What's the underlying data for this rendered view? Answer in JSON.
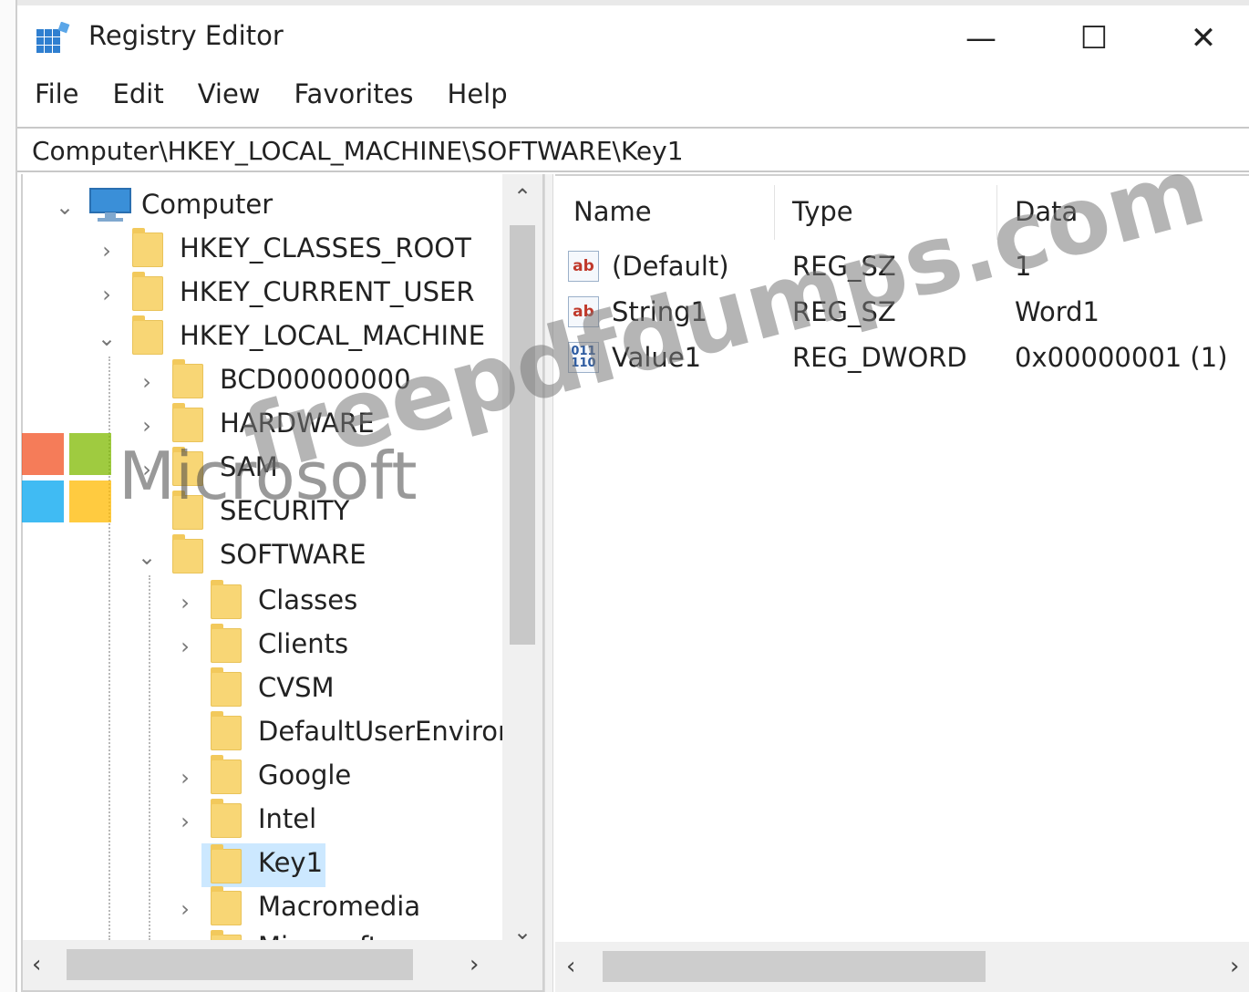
{
  "window": {
    "title": "Registry Editor",
    "controls": {
      "minimize": "—",
      "maximize": "☐",
      "close": "✕"
    }
  },
  "menu": [
    "File",
    "Edit",
    "View",
    "Favorites",
    "Help"
  ],
  "address": "Computer\\HKEY_LOCAL_MACHINE\\SOFTWARE\\Key1",
  "tree": {
    "root": "Computer",
    "hives": [
      "HKEY_CLASSES_ROOT",
      "HKEY_CURRENT_USER",
      "HKEY_LOCAL_MACHINE"
    ],
    "hklm_children": [
      "BCD00000000",
      "HARDWARE",
      "SAM",
      "SECURITY",
      "SOFTWARE"
    ],
    "software_children": [
      "Classes",
      "Clients",
      "CVSM",
      "DefaultUserEnvironn",
      "Google",
      "Intel",
      "Key1",
      "Macromedia",
      "Microsoft"
    ],
    "selected": "Key1"
  },
  "values_table": {
    "columns": [
      "Name",
      "Type",
      "Data"
    ],
    "rows": [
      {
        "icon": "string-value-icon",
        "badge": "ab",
        "name": "(Default)",
        "type": "REG_SZ",
        "data": "1"
      },
      {
        "icon": "string-value-icon",
        "badge": "ab",
        "name": "String1",
        "type": "REG_SZ",
        "data": "Word1"
      },
      {
        "icon": "dword-value-icon",
        "badge": "011\n110",
        "name": "Value1",
        "type": "REG_DWORD",
        "data": "0x00000001 (1)"
      }
    ]
  },
  "watermark": {
    "brand": "Microsoft",
    "site": "freepdfdumps.com"
  },
  "colors": {
    "selection": "#cce8ff",
    "folder": "#f8d675",
    "computer_icon": "#3a8fd8"
  }
}
